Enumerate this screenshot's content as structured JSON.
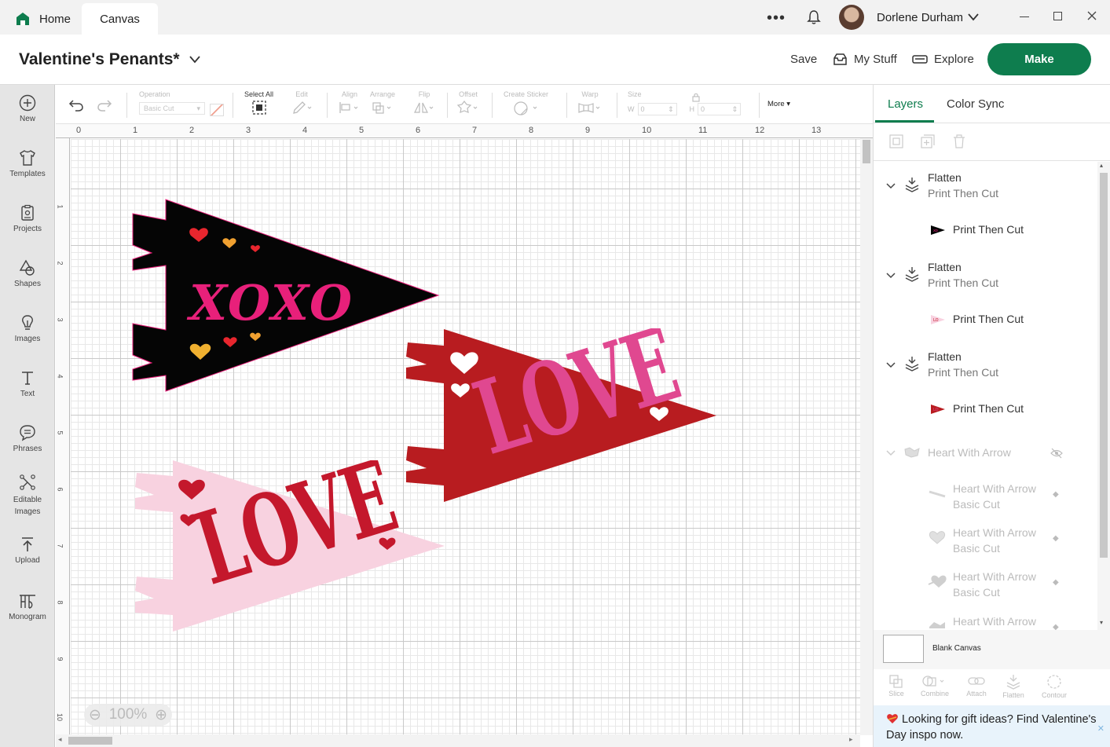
{
  "titlebar": {
    "tabs": [
      {
        "label": "Home"
      },
      {
        "label": "Canvas"
      }
    ],
    "user_name": "Dorlene Durham"
  },
  "header": {
    "project_title": "Valentine's Penants*",
    "save_label": "Save",
    "my_stuff_label": "My Stuff",
    "explore_label": "Explore",
    "make_label": "Make"
  },
  "sidebar": {
    "items": [
      {
        "label": "New",
        "icon": "plus-circle-icon"
      },
      {
        "label": "Templates",
        "icon": "shirt-icon"
      },
      {
        "label": "Projects",
        "icon": "clipboard-icon"
      },
      {
        "label": "Shapes",
        "icon": "shapes-icon"
      },
      {
        "label": "Images",
        "icon": "bulb-icon"
      },
      {
        "label": "Text",
        "icon": "text-t-icon"
      },
      {
        "label": "Phrases",
        "icon": "speech-bubble-icon"
      },
      {
        "label": "Editable Images",
        "icon": "editable-image-icon"
      },
      {
        "label": "Upload",
        "icon": "upload-icon"
      },
      {
        "label": "Monogram",
        "icon": "monogram-icon"
      }
    ]
  },
  "toolbar": {
    "operation_label": "Operation",
    "operation_value": "Basic Cut",
    "select_all_label": "Select All",
    "edit_label": "Edit",
    "align_label": "Align",
    "arrange_label": "Arrange",
    "flip_label": "Flip",
    "offset_label": "Offset",
    "create_sticker_label": "Create Sticker",
    "warp_label": "Warp",
    "size_label": "Size",
    "w_label": "W",
    "h_label": "H",
    "w_value": "0",
    "h_value": "0",
    "more_label": "More"
  },
  "canvas": {
    "ruler_top": [
      "0",
      "1",
      "2",
      "3",
      "4",
      "5",
      "6",
      "7",
      "8",
      "9",
      "10",
      "11",
      "12",
      "13"
    ],
    "ruler_left": [
      "1",
      "2",
      "3",
      "4",
      "5",
      "6",
      "7",
      "8",
      "9",
      "10"
    ],
    "zoom": "100%",
    "pennants": [
      {
        "text": "XOXO",
        "fill": "#050505",
        "text_color": "#e8207a"
      },
      {
        "text": "LOVE",
        "fill": "#b81c20",
        "text_color": "#e04890"
      },
      {
        "text": "LOVE",
        "fill": "#f8d2e0",
        "text_color": "#c4182c"
      }
    ]
  },
  "panel": {
    "tabs": [
      {
        "label": "Layers"
      },
      {
        "label": "Color Sync"
      }
    ],
    "groups": [
      {
        "name": "Flatten",
        "sub": "Print Then Cut",
        "child": "Print Then Cut"
      },
      {
        "name": "Flatten",
        "sub": "Print Then Cut",
        "child": "Print Then Cut"
      },
      {
        "name": "Flatten",
        "sub": "Print Then Cut",
        "child": "Print Then Cut"
      }
    ],
    "hidden_group": {
      "name": "Heart With Arrow",
      "children": [
        {
          "name": "Heart With Arrow",
          "sub": "Basic Cut"
        },
        {
          "name": "Heart With Arrow",
          "sub": "Basic Cut"
        },
        {
          "name": "Heart With Arrow",
          "sub": "Basic Cut"
        },
        {
          "name": "Heart With Arrow",
          "sub": ""
        }
      ]
    },
    "blank_canvas_label": "Blank Canvas",
    "bottom_tools": [
      "Slice",
      "Combine",
      "Attach",
      "Flatten",
      "Contour"
    ],
    "promo_text": "Looking for gift ideas? Find Valentine's Day inspo now."
  },
  "colors": {
    "brand_green": "#0e7d4e",
    "accent_blue": "#0e7d4e"
  }
}
